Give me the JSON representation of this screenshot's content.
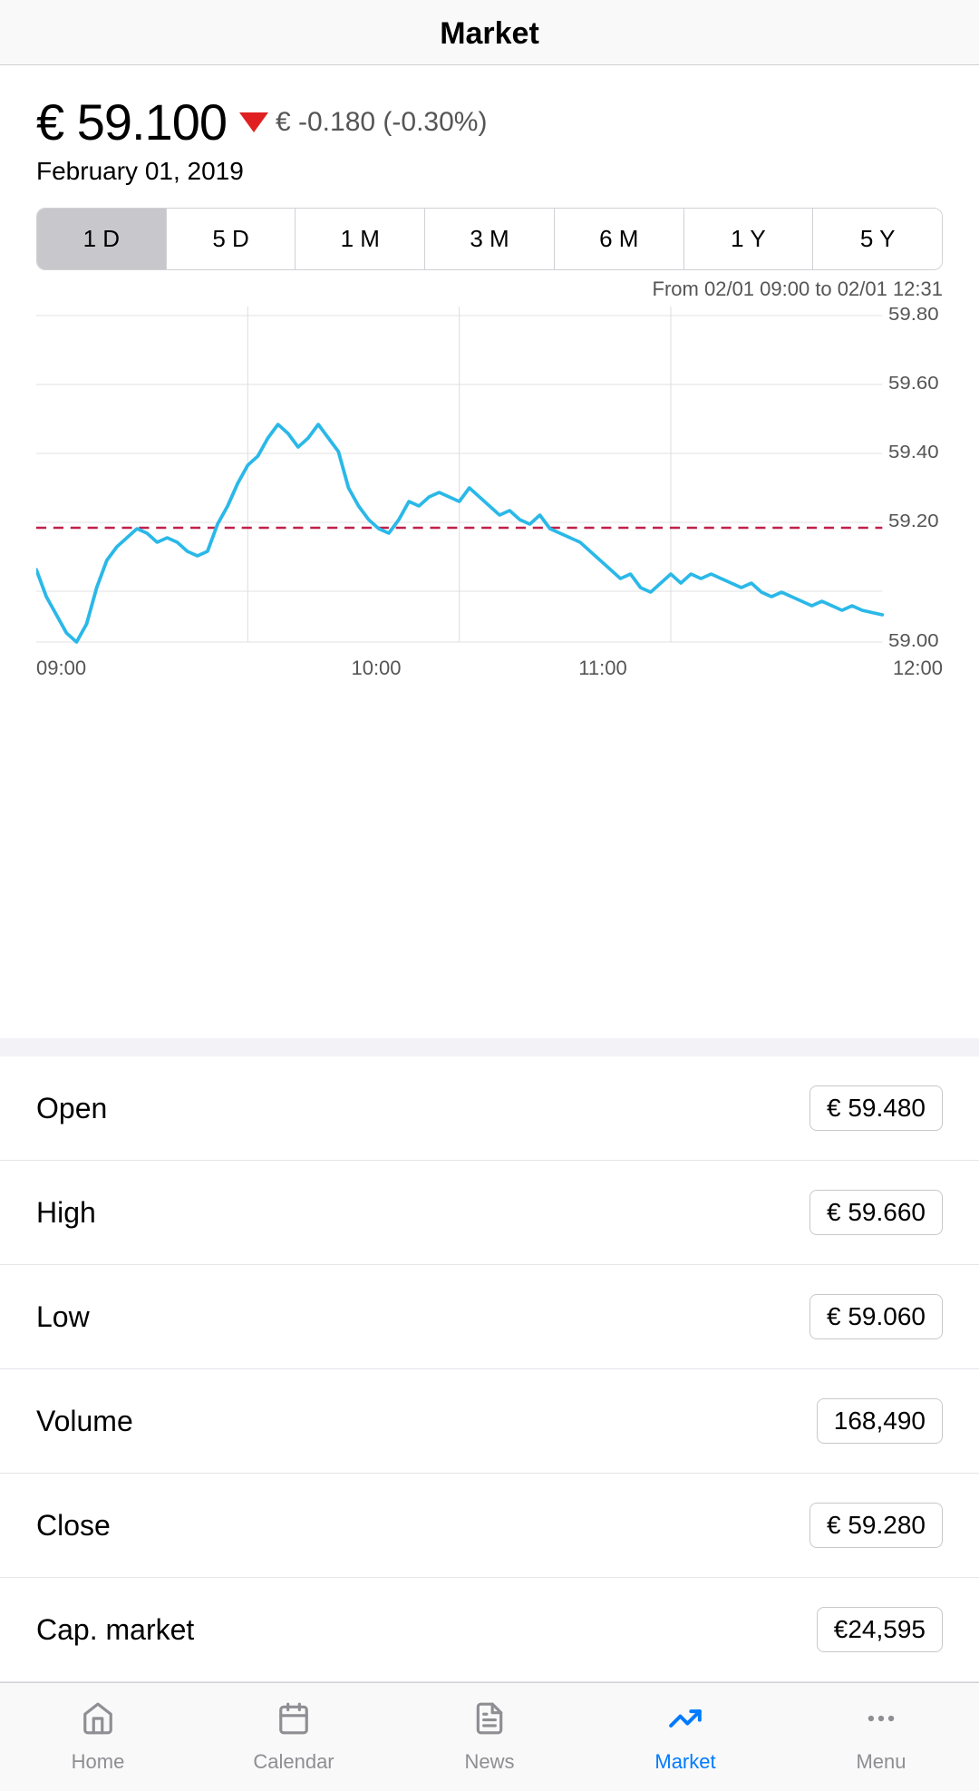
{
  "header": {
    "title": "Market"
  },
  "price": {
    "currency": "€",
    "value": "59.100",
    "change": "€ -0.180 (-0.30%)",
    "date": "February 01, 2019"
  },
  "timeRanges": [
    {
      "label": "1 D",
      "active": true
    },
    {
      "label": "5 D",
      "active": false
    },
    {
      "label": "1 M",
      "active": false
    },
    {
      "label": "3 M",
      "active": false
    },
    {
      "label": "6 M",
      "active": false
    },
    {
      "label": "1 Y",
      "active": false
    },
    {
      "label": "5 Y",
      "active": false
    }
  ],
  "chart": {
    "rangeLabel": "From 02/01 09:00 to 02/01 12:31",
    "xLabels": [
      "09:00",
      "10:00",
      "11:00",
      "12:00"
    ],
    "yLabels": [
      "59.80",
      "59.60",
      "59.40",
      "59.20",
      "59.00"
    ]
  },
  "stats": [
    {
      "label": "Open",
      "value": "€ 59.480"
    },
    {
      "label": "High",
      "value": "€ 59.660"
    },
    {
      "label": "Low",
      "value": "€ 59.060"
    },
    {
      "label": "Volume",
      "value": "168,490"
    },
    {
      "label": "Close",
      "value": "€ 59.280"
    },
    {
      "label": "Cap. market",
      "value": "€24,595"
    }
  ],
  "tabs": [
    {
      "label": "Home",
      "icon": "🏠",
      "active": false
    },
    {
      "label": "Calendar",
      "icon": "📅",
      "active": false
    },
    {
      "label": "News",
      "icon": "📋",
      "active": false
    },
    {
      "label": "Market",
      "icon": "📈",
      "active": true
    },
    {
      "label": "Menu",
      "icon": "···",
      "active": false
    }
  ],
  "colors": {
    "accent": "#007aff",
    "down": "#e02020",
    "chartLine": "#2ab8e8",
    "refLine": "#c0204a"
  }
}
